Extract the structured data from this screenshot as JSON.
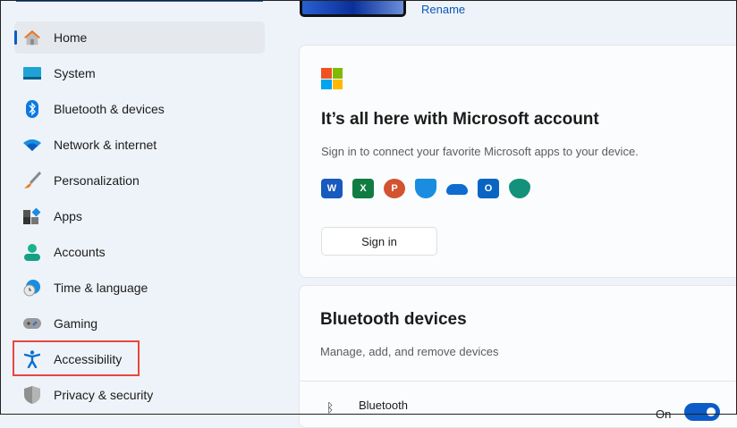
{
  "sidebar": {
    "items": [
      {
        "label": "Home",
        "icon": "home-icon"
      },
      {
        "label": "System",
        "icon": "monitor-icon"
      },
      {
        "label": "Bluetooth & devices",
        "icon": "bluetooth-icon"
      },
      {
        "label": "Network & internet",
        "icon": "wifi-icon"
      },
      {
        "label": "Personalization",
        "icon": "brush-icon"
      },
      {
        "label": "Apps",
        "icon": "apps-icon"
      },
      {
        "label": "Accounts",
        "icon": "person-icon"
      },
      {
        "label": "Time & language",
        "icon": "globe-clock-icon"
      },
      {
        "label": "Gaming",
        "icon": "gamepad-icon"
      },
      {
        "label": "Accessibility",
        "icon": "accessibility-icon"
      },
      {
        "label": "Privacy & security",
        "icon": "shield-icon"
      }
    ]
  },
  "device": {
    "rename": "Rename"
  },
  "account_card": {
    "title": "It’s all here with Microsoft account",
    "subtitle": "Sign in to connect your favorite Microsoft apps to your device.",
    "apps": [
      "W",
      "X",
      "P",
      "",
      "",
      "O",
      ""
    ],
    "sign_in": "Sign in"
  },
  "bluetooth_card": {
    "title": "Bluetooth devices",
    "subtitle": "Manage, add, and remove devices",
    "row_label": "Bluetooth",
    "state": "On"
  }
}
